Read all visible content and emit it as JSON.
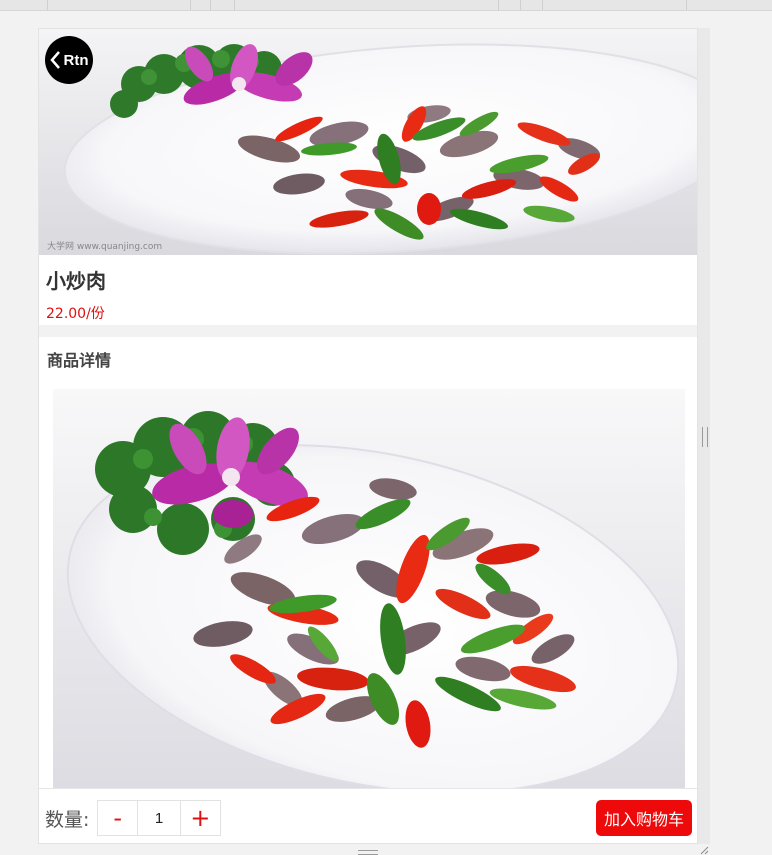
{
  "header": {
    "back_label": "Rtn"
  },
  "product": {
    "name": "小炒肉",
    "price": "22.00/份",
    "hero_watermark": "大学网 www.quanjing.com"
  },
  "details": {
    "title": "商品详情"
  },
  "footer": {
    "quantity_label": "数量:",
    "minus_label": "-",
    "quantity_value": "1",
    "plus_label": "+",
    "add_to_cart_label": "加入购物车"
  },
  "colors": {
    "accent": "#ee0a0a",
    "price": "#e01010",
    "back_button": "#000000"
  }
}
